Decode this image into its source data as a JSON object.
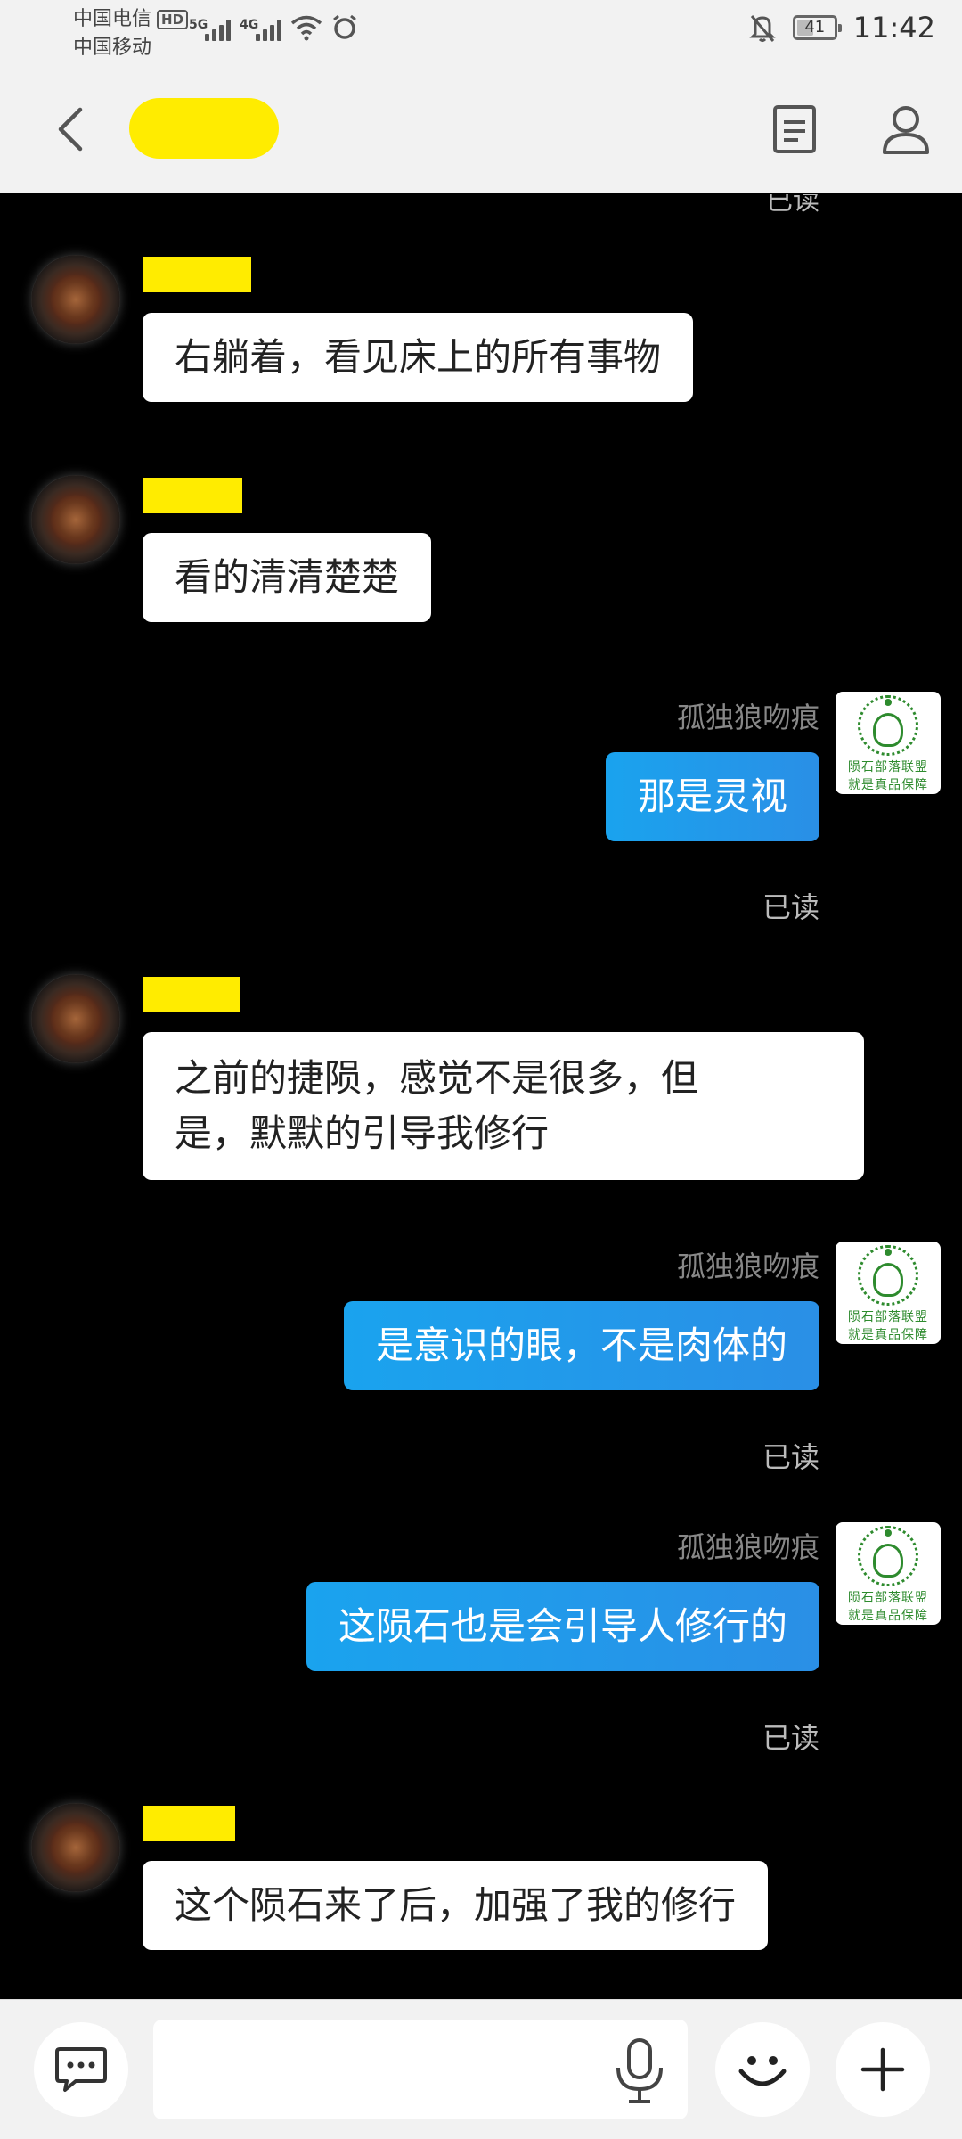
{
  "status_bar": {
    "carrier1": "中国电信",
    "carrier1_badge": "HD",
    "carrier2": "中国移动",
    "network1": "5G",
    "network2": "4G",
    "battery": "41",
    "time": "11:42"
  },
  "header": {
    "title": "",
    "back_icon": "chevron-left-icon",
    "doc_icon": "document-icon",
    "profile_icon": "person-icon"
  },
  "chat": {
    "partial_read": "已读",
    "messages": [
      {
        "side": "left",
        "text": "右躺着，看见床上的所有事物"
      },
      {
        "side": "left",
        "text": "看的清清楚楚"
      },
      {
        "side": "right",
        "sender": "孤独狼吻痕",
        "text": "那是灵视",
        "status": "已读"
      },
      {
        "side": "left",
        "text": "之前的捷陨，感觉不是很多，但\n是，默默的引导我修行"
      },
      {
        "side": "right",
        "sender": "孤独狼吻痕",
        "text": "是意识的眼，不是肉体的",
        "status": "已读"
      },
      {
        "side": "right",
        "sender": "孤独狼吻痕",
        "text": "这陨石也是会引导人修行的",
        "status": "已读"
      },
      {
        "side": "left",
        "text": "这个陨石来了后，加强了我的修行"
      }
    ],
    "right_avatar_caption_line1": "陨石部落联盟",
    "right_avatar_caption_line2": "就是真品保障"
  },
  "input_bar": {
    "placeholder": "",
    "chat_icon": "chat-bubble-icon",
    "mic_icon": "microphone-icon",
    "emoji_icon": "smiley-icon",
    "plus_icon": "plus-icon"
  },
  "colors": {
    "accent_bubble": "#1aa3ee",
    "highlight": "#ffec00",
    "background": "#000000"
  }
}
